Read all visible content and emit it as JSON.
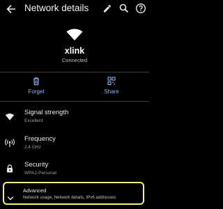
{
  "header": {
    "title": "Network details",
    "icons": [
      "back-arrow-icon",
      "edit-pencil-icon",
      "search-icon",
      "help-icon"
    ]
  },
  "network": {
    "ssid": "xlink",
    "status": "Connected"
  },
  "actions": {
    "forget_label": "Forget",
    "share_label": "Share"
  },
  "details": [
    {
      "title": "Signal strength",
      "value": "Excellent",
      "icon": "wifi-signal-icon"
    },
    {
      "title": "Frequency",
      "value": "2.4 GHz",
      "icon": "antenna-icon"
    },
    {
      "title": "Security",
      "value": "WPA2-Personal",
      "icon": "lock-icon"
    }
  ],
  "advanced": {
    "title": "Advanced",
    "summary": "Network usage, Network details, IPv6 addresses",
    "icon": "chevron-down-icon"
  },
  "colors": {
    "background": "#000000",
    "accent": "#8ab4f8",
    "highlight": "#f3f37a"
  }
}
